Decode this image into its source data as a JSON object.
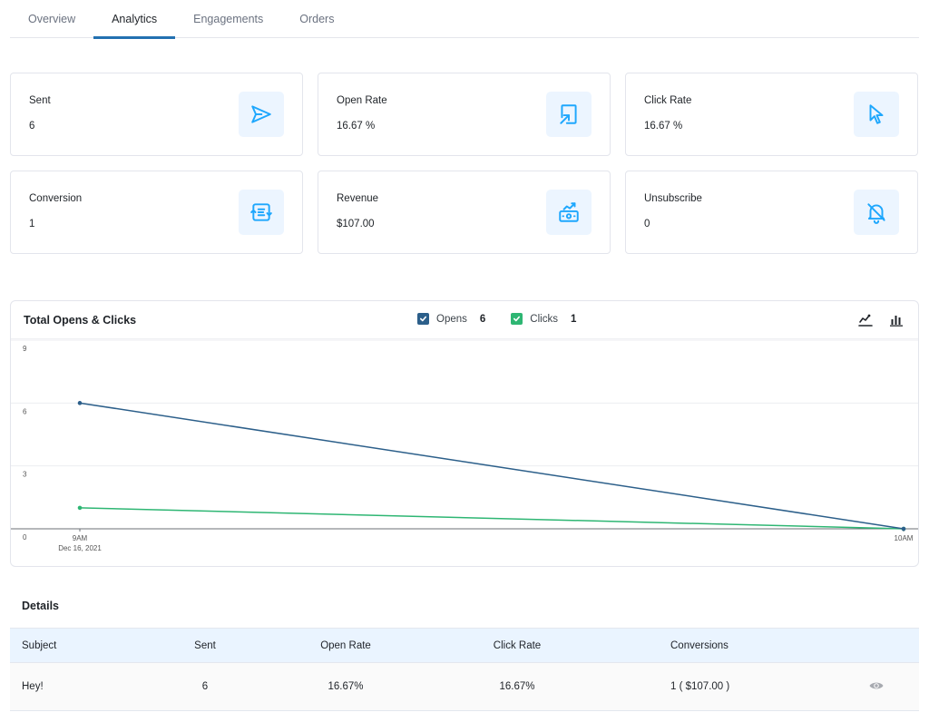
{
  "tabs": [
    {
      "label": "Overview",
      "active": false
    },
    {
      "label": "Analytics",
      "active": true
    },
    {
      "label": "Engagements",
      "active": false
    },
    {
      "label": "Orders",
      "active": false
    }
  ],
  "cards": [
    {
      "label": "Sent",
      "value": "6",
      "icon": "send-icon"
    },
    {
      "label": "Open Rate",
      "value": "16.67 %",
      "icon": "open-external-icon"
    },
    {
      "label": "Click Rate",
      "value": "16.67 %",
      "icon": "cursor-pointer-icon"
    },
    {
      "label": "Conversion",
      "value": "1",
      "icon": "conversion-exchange-icon"
    },
    {
      "label": "Revenue",
      "value": "$107.00",
      "icon": "money-growth-icon"
    },
    {
      "label": "Unsubscribe",
      "value": "0",
      "icon": "bell-off-icon"
    }
  ],
  "colors": {
    "accent": "#2271b1",
    "icon_blue": "#1ea7fd",
    "icon_bg": "#ecf5ff",
    "opens": "#2c5f8a",
    "clicks": "#2eb673"
  },
  "chart": {
    "title": "Total Opens & Clicks",
    "legend": [
      {
        "label": "Opens",
        "count": "6"
      },
      {
        "label": "Clicks",
        "count": "1"
      }
    ],
    "tools": [
      "line-chart-icon",
      "bar-chart-icon"
    ]
  },
  "chart_data": {
    "type": "line",
    "title": "Total Opens & Clicks",
    "x": [
      "9AM",
      "10AM"
    ],
    "x_sublabels": [
      "Dec 16, 2021",
      ""
    ],
    "series": [
      {
        "name": "Opens",
        "values": [
          6,
          0
        ],
        "color": "#2c5f8a"
      },
      {
        "name": "Clicks",
        "values": [
          1,
          0
        ],
        "color": "#2eb673"
      }
    ],
    "yticks": [
      0,
      3,
      6,
      9
    ],
    "ylim": [
      0,
      9
    ],
    "grid": true,
    "legend": "top-center",
    "xlabel": "",
    "ylabel": ""
  },
  "details": {
    "title": "Details",
    "columns": [
      "Subject",
      "Sent",
      "Open Rate",
      "Click Rate",
      "Conversions",
      ""
    ],
    "rows": [
      {
        "subject": "Hey!",
        "sent": "6",
        "open_rate": "16.67%",
        "click_rate": "16.67%",
        "conversions": "1 ( $107.00 )",
        "action_icon": "eye-icon"
      }
    ]
  }
}
